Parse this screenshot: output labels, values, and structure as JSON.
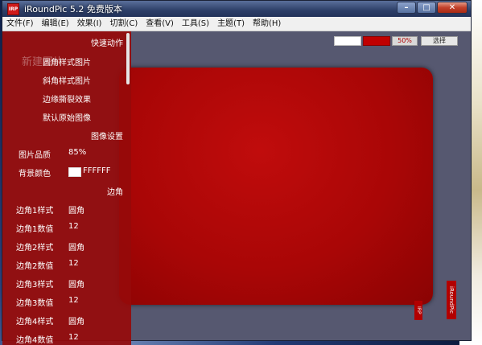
{
  "window": {
    "title": "iRoundPic 5.2 免费版本",
    "icon_label": "IRP",
    "controls": {
      "minimize": "–",
      "maximize": "□",
      "close": "✕"
    }
  },
  "menu": [
    "文件(F)",
    "编辑(E)",
    "效果(I)",
    "切割(C)",
    "查看(V)",
    "工具(S)",
    "主题(T)",
    "帮助(H)"
  ],
  "toolbar": {
    "percent": "50%",
    "select_label": "选择",
    "swatch_left_color": "#ffffff",
    "swatch_right_color": "#c00000"
  },
  "panel": {
    "ghost_text": "新建图片",
    "quick_actions_header": "快速动作",
    "actions": [
      "圆角样式图片",
      "斜角样式图片",
      "边缘撕裂效果",
      "默认原始图像"
    ],
    "image_settings_header": "图像设置",
    "quality_label": "图片品质",
    "quality_value": "85%",
    "bg_label": "背景颜色",
    "bg_value": "FFFFFF",
    "corners_header": "边角",
    "corner_rows": [
      {
        "label": "边角1样式",
        "value": "圆角"
      },
      {
        "label": "边角1数值",
        "value": "12"
      },
      {
        "label": "边角2样式",
        "value": "圆角"
      },
      {
        "label": "边角2数值",
        "value": "12"
      },
      {
        "label": "边角3样式",
        "value": "圆角"
      },
      {
        "label": "边角3数值",
        "value": "12"
      },
      {
        "label": "边角4样式",
        "value": "圆角"
      },
      {
        "label": "边角4数值",
        "value": "12"
      }
    ]
  },
  "canvas": {
    "stamp_text": "iRoundPic",
    "stamp_text_small": "IRP"
  },
  "colors": {
    "panel_red": "#960a0a",
    "image_red": "#b00808",
    "workspace": "#565870"
  }
}
